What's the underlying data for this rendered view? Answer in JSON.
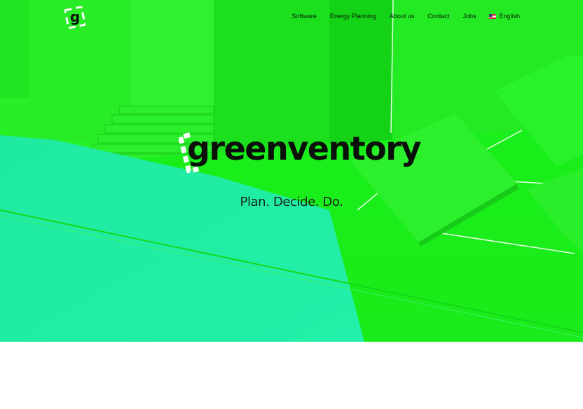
{
  "nav": {
    "items": [
      {
        "label": "Software"
      },
      {
        "label": "Energy Planning"
      },
      {
        "label": "About us"
      },
      {
        "label": "Contact"
      },
      {
        "label": "Jobs"
      }
    ],
    "language": "English",
    "language_flag_icon": "us-flag-icon"
  },
  "logo": {
    "letter": "g",
    "icon": "greenventory-logo-icon"
  },
  "hero": {
    "brand_name": "greenventory",
    "tagline": "Plan. Decide. Do."
  },
  "colors": {
    "hero_green": "#22f21e",
    "hero_cyan": "#1ff0a0",
    "text_dark": "#0b100b",
    "background": "#ffffff"
  }
}
